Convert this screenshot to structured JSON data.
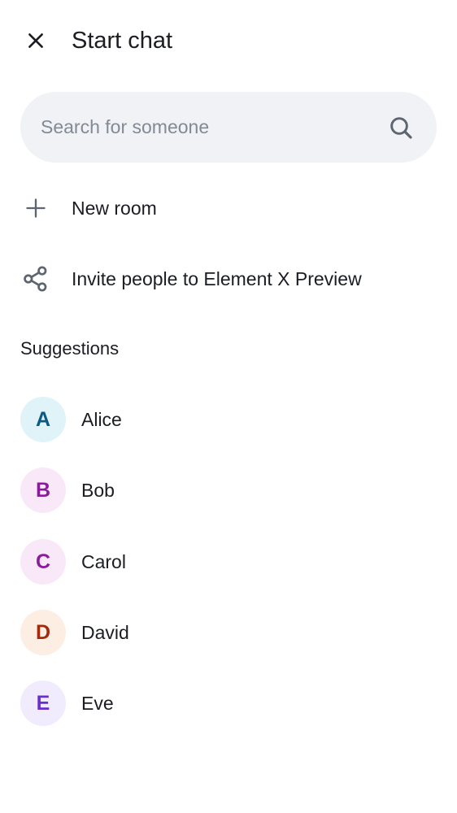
{
  "header": {
    "title": "Start chat"
  },
  "search": {
    "placeholder": "Search for someone",
    "value": ""
  },
  "actions": [
    {
      "label": "New room",
      "icon": "plus-icon"
    },
    {
      "label": "Invite people to Element X Preview",
      "icon": "share-icon"
    }
  ],
  "suggestions": {
    "title": "Suggestions",
    "items": [
      {
        "initial": "A",
        "name": "Alice",
        "bg": "#e0f3f8",
        "fg": "#0b5a82"
      },
      {
        "initial": "B",
        "name": "Bob",
        "bg": "#f9e9f8",
        "fg": "#8a1c9c"
      },
      {
        "initial": "C",
        "name": "Carol",
        "bg": "#f9e9f8",
        "fg": "#8a1c9c"
      },
      {
        "initial": "D",
        "name": "David",
        "bg": "#fdeee4",
        "fg": "#a52a0c"
      },
      {
        "initial": "E",
        "name": "Eve",
        "bg": "#f0ebfd",
        "fg": "#6a2fc8"
      }
    ]
  }
}
